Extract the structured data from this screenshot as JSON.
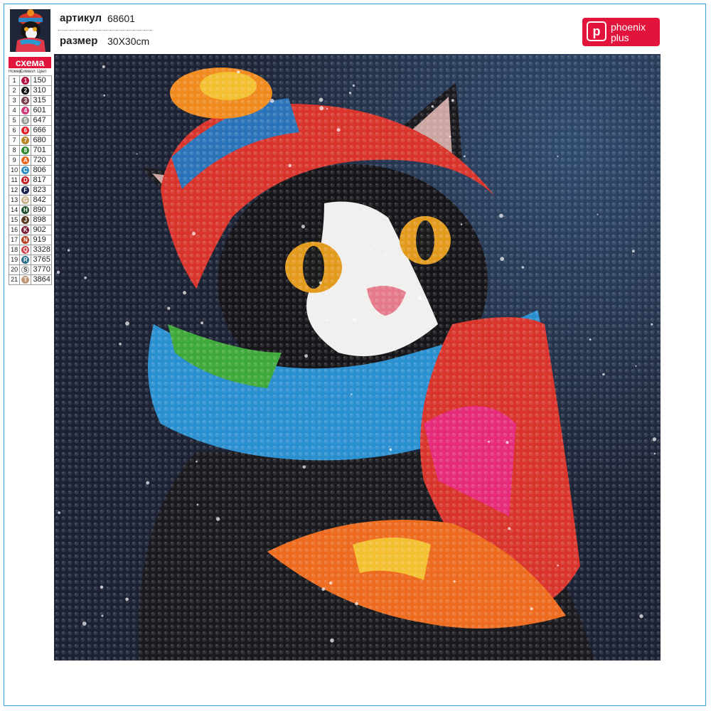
{
  "header": {
    "article_label": "артикул",
    "article_value": "68601",
    "size_label": "размер",
    "size_value": "30X30cm"
  },
  "logo": {
    "mark": "p",
    "line1": "phoenix",
    "line2": "plus"
  },
  "legend": {
    "title": "схема",
    "columns": [
      "Номер",
      "Символ",
      "Цвет"
    ],
    "rows": [
      {
        "num": "1",
        "symbol": "1",
        "color": "150",
        "hex": "#b5123f"
      },
      {
        "num": "2",
        "symbol": "2",
        "color": "310",
        "hex": "#111111"
      },
      {
        "num": "3",
        "symbol": "3",
        "color": "315",
        "hex": "#7a3d4c"
      },
      {
        "num": "4",
        "symbol": "4",
        "color": "601",
        "hex": "#d23b7a"
      },
      {
        "num": "5",
        "symbol": "5",
        "color": "647",
        "hex": "#9aa39a"
      },
      {
        "num": "6",
        "symbol": "6",
        "color": "666",
        "hex": "#e3202a"
      },
      {
        "num": "7",
        "symbol": "7",
        "color": "680",
        "hex": "#b8862c"
      },
      {
        "num": "8",
        "symbol": "8",
        "color": "701",
        "hex": "#2f8a2f"
      },
      {
        "num": "9",
        "symbol": "A",
        "color": "720",
        "hex": "#e8621a"
      },
      {
        "num": "10",
        "symbol": "C",
        "color": "806",
        "hex": "#2c8fbf"
      },
      {
        "num": "11",
        "symbol": "D",
        "color": "817",
        "hex": "#c41a1f"
      },
      {
        "num": "12",
        "symbol": "F",
        "color": "823",
        "hex": "#1c2450"
      },
      {
        "num": "13",
        "symbol": "G",
        "color": "842",
        "hex": "#c9b08c"
      },
      {
        "num": "14",
        "symbol": "H",
        "color": "890",
        "hex": "#1d4f2a"
      },
      {
        "num": "15",
        "symbol": "J",
        "color": "898",
        "hex": "#5a3a22"
      },
      {
        "num": "16",
        "symbol": "K",
        "color": "902",
        "hex": "#7a1f35"
      },
      {
        "num": "17",
        "symbol": "N",
        "color": "919",
        "hex": "#b54121"
      },
      {
        "num": "18",
        "symbol": "Q",
        "color": "3328",
        "hex": "#c9464e"
      },
      {
        "num": "19",
        "symbol": "R",
        "color": "3765",
        "hex": "#2b6f8c"
      },
      {
        "num": "20",
        "symbol": "S",
        "color": "3770",
        "hex": "#ffffff"
      },
      {
        "num": "21",
        "symbol": "T",
        "color": "3864",
        "hex": "#c29a7a"
      }
    ]
  }
}
